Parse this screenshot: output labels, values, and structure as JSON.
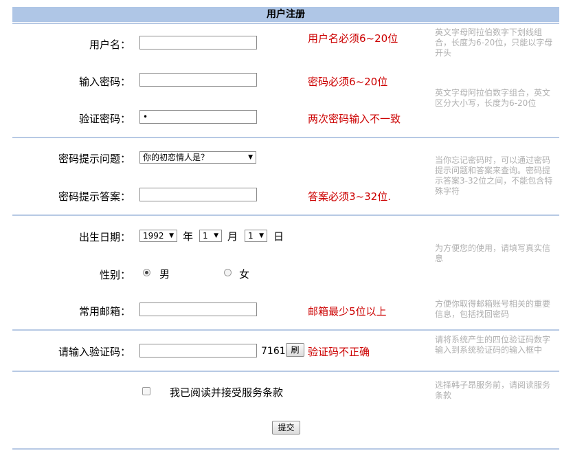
{
  "form": {
    "title": "用户注册",
    "username": {
      "label": "用户名：",
      "value": "",
      "error": "用户名必须6~20位",
      "hint": "英文字母阿拉伯数字下划线组合，长度为6-20位，只能以字母开头"
    },
    "password": {
      "label": "输入密码：",
      "value": "",
      "error": "密码必须6~20位",
      "hint": "英文字母阿拉伯数字组合，英文区分大小写，长度为6-20位"
    },
    "confirm_password": {
      "label": "验证密码：",
      "value": "•",
      "error": "两次密码输入不一致"
    },
    "question": {
      "label": "密码提示问题：",
      "selected": "你的初恋情人是？",
      "hint": "当你忘记密码时，可以通过密码提示问题和答案来查询。密码提示答案3-32位之间，不能包含特殊字符"
    },
    "answer": {
      "label": "密码提示答案：",
      "value": "",
      "error": "答案必须3~32位."
    },
    "birthday": {
      "label": "出生日期：",
      "year": "1992",
      "year_unit": "年",
      "month": "1",
      "month_unit": "月",
      "day": "1",
      "day_unit": "日",
      "hint": "为方便您的使用，请填写真实信息"
    },
    "gender": {
      "label": "性别：",
      "male": "男",
      "female": "女",
      "selected": "男"
    },
    "email": {
      "label": "常用邮箱：",
      "value": "",
      "error": "邮箱最少5位以上",
      "hint": "方便你取得邮箱账号相关的重要信息，包括找回密码"
    },
    "captcha": {
      "label": "请输入验证码：",
      "value": "",
      "code": "7161",
      "refresh_label": "刷",
      "error": "验证码不正确",
      "hint": "请将系统产生的四位验证码数字输入到系统验证码的输入框中"
    },
    "terms": {
      "label": "我已阅读并接受服务条款",
      "hint": "选择韩子昂服务前，请阅读服务条款"
    },
    "submit_label": "提交"
  },
  "colors": {
    "header_bg": "#afc6e6",
    "separator": "#b7c9e4",
    "error": "#cc0000",
    "hint": "#b0b0b0"
  }
}
